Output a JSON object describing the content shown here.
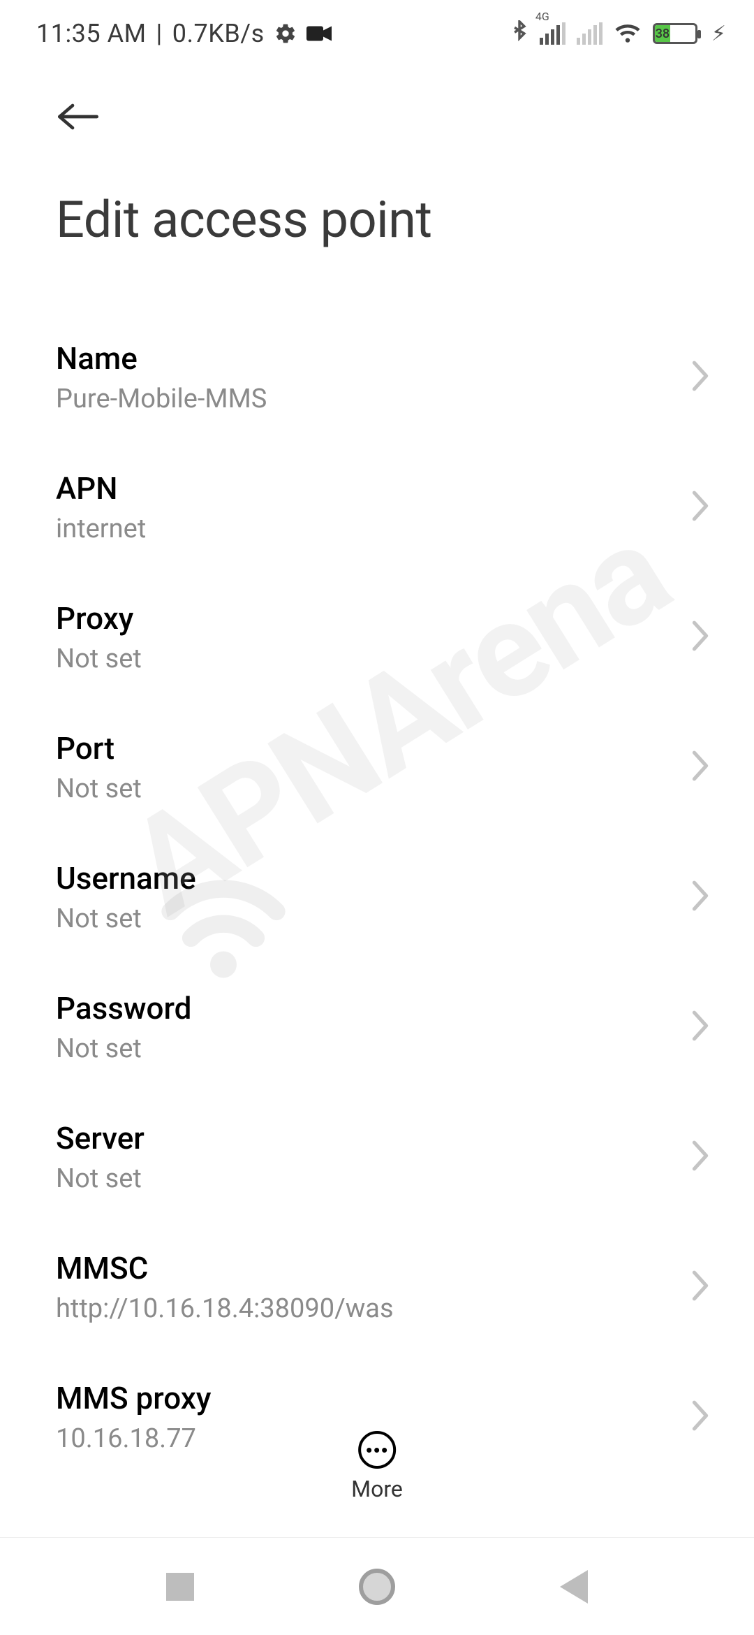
{
  "status": {
    "time": "11:35 AM",
    "netspeed": "0.7KB/s",
    "battery_pct": "38"
  },
  "header": {
    "title": "Edit access point"
  },
  "rows": [
    {
      "label": "Name",
      "value": "Pure-Mobile-MMS"
    },
    {
      "label": "APN",
      "value": "internet"
    },
    {
      "label": "Proxy",
      "value": "Not set"
    },
    {
      "label": "Port",
      "value": "Not set"
    },
    {
      "label": "Username",
      "value": "Not set"
    },
    {
      "label": "Password",
      "value": "Not set"
    },
    {
      "label": "Server",
      "value": "Not set"
    },
    {
      "label": "MMSC",
      "value": "http://10.16.18.4:38090/was"
    },
    {
      "label": "MMS proxy",
      "value": "10.16.18.77"
    }
  ],
  "more_label": "More",
  "watermark": "APNArena"
}
